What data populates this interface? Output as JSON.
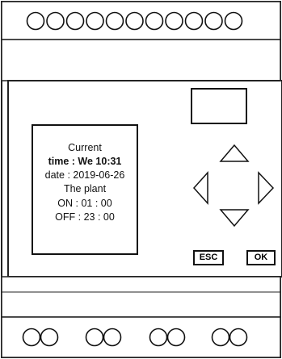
{
  "device": {
    "top_terminals": {
      "count": 11
    },
    "bottom_terminals": {
      "groups": 4,
      "per_group": 2
    },
    "display": {
      "lines": [
        "Current",
        "time : We 10:31",
        "date : 2019-06-26",
        "The plant",
        "ON : 01 : 00",
        "OFF : 23 : 00"
      ]
    },
    "buttons": {
      "esc_label": "ESC",
      "ok_label": "OK",
      "arrow_icons": [
        "up-arrow-icon",
        "left-arrow-icon",
        "right-arrow-icon",
        "down-arrow-icon"
      ]
    }
  }
}
